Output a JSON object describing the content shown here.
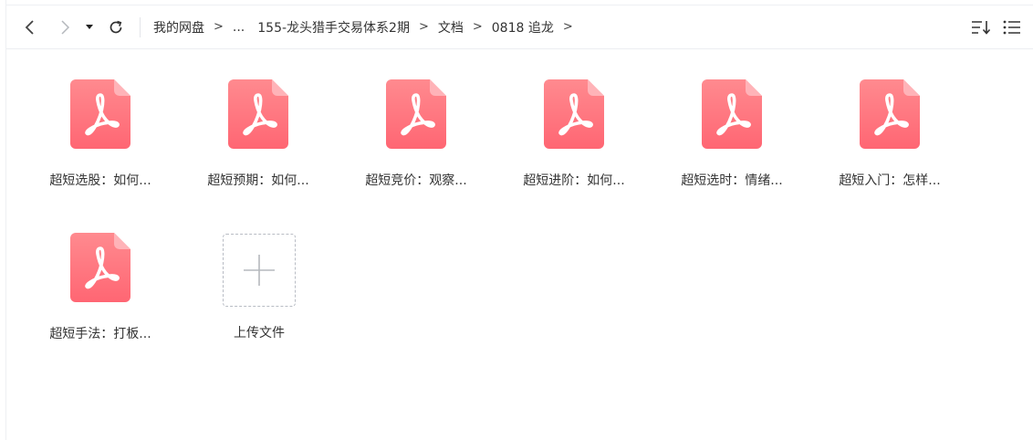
{
  "toolbar": {
    "back_icon": "chevron-left-icon",
    "forward_icon": "chevron-right-icon",
    "dropdown_icon": "caret-down-icon",
    "refresh_icon": "refresh-icon",
    "sort_icon": "sort-icon",
    "view_icon": "list-view-icon"
  },
  "breadcrumb": {
    "root": "我的网盘",
    "ellipsis": "...",
    "level1": "155-龙头猎手交易体系2期",
    "level2": "文档",
    "level3": "0818 追龙",
    "separator": ">"
  },
  "files": [
    {
      "name": "超短选股：如何...",
      "type": "pdf"
    },
    {
      "name": "超短预期：如何...",
      "type": "pdf"
    },
    {
      "name": "超短竞价：观察...",
      "type": "pdf"
    },
    {
      "name": "超短进阶：如何...",
      "type": "pdf"
    },
    {
      "name": "超短选时：情绪...",
      "type": "pdf"
    },
    {
      "name": "超短入门：怎样...",
      "type": "pdf"
    },
    {
      "name": "超短手法：打板...",
      "type": "pdf"
    }
  ],
  "upload": {
    "label": "上传文件",
    "icon": "plus-icon"
  },
  "colors": {
    "pdf_top": "#ff8a8f",
    "pdf_bottom": "#ff6673",
    "pdf_fold": "#ffb3b8"
  }
}
